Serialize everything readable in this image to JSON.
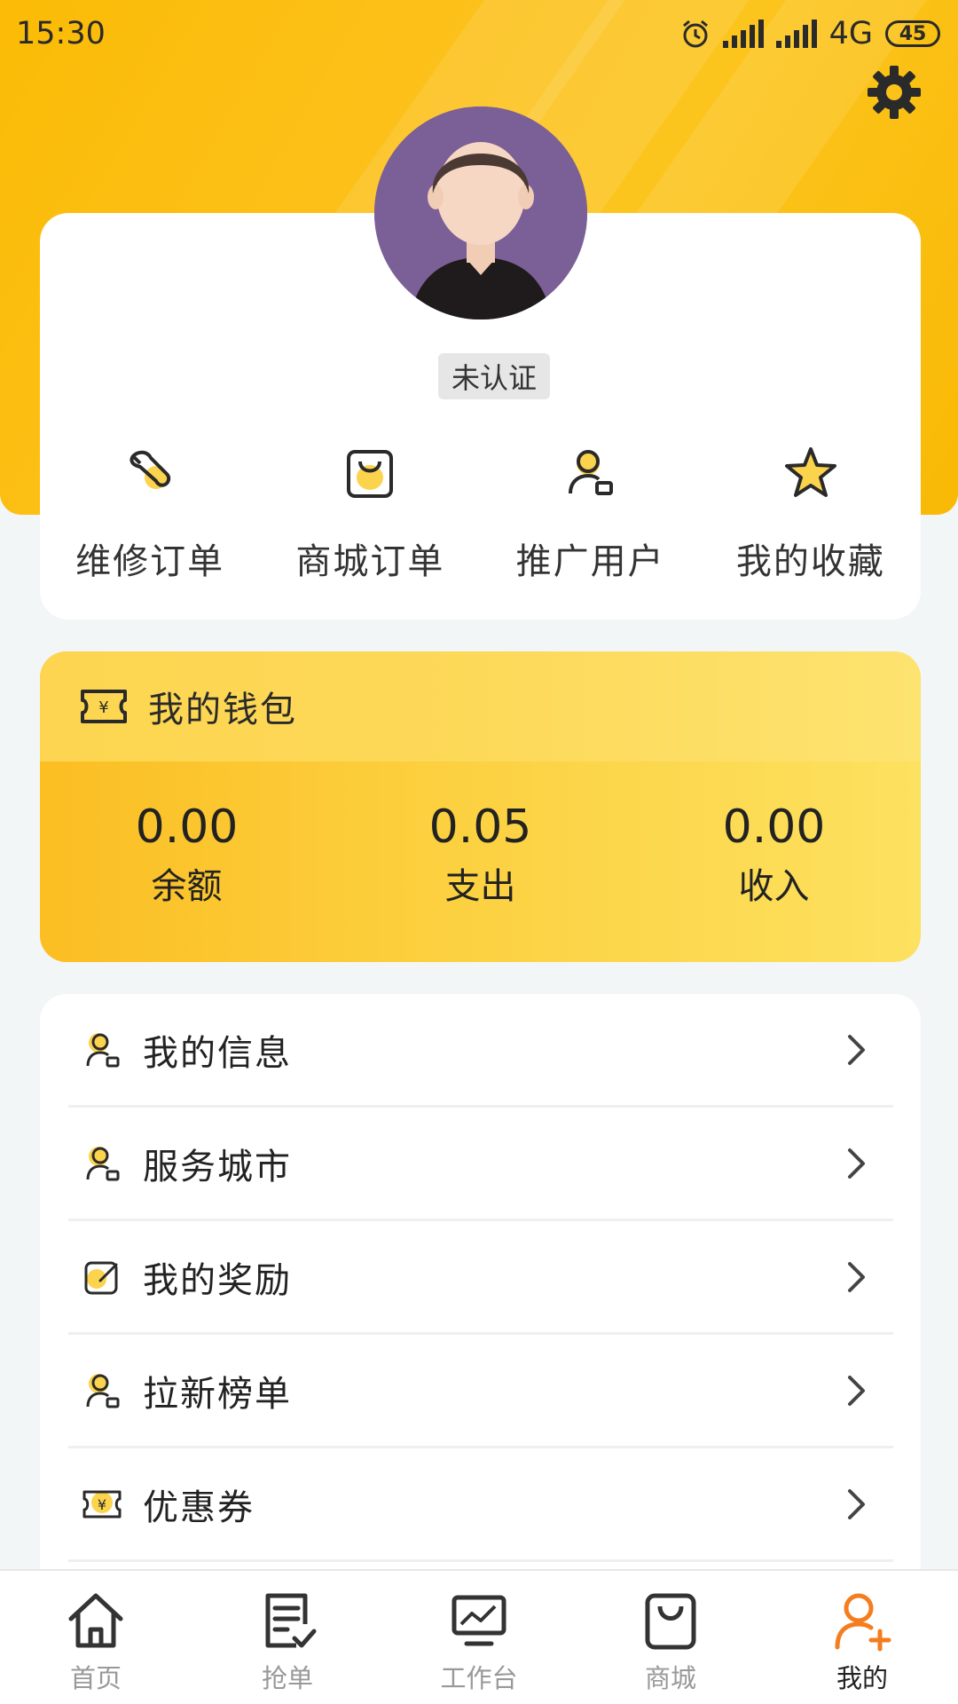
{
  "status_bar": {
    "time": "15:30",
    "network": "4G",
    "battery": "45"
  },
  "profile": {
    "verify_status": "未认证"
  },
  "quick_actions": [
    {
      "label": "维修订单",
      "icon": "wrench-icon"
    },
    {
      "label": "商城订单",
      "icon": "shopping-bag-icon"
    },
    {
      "label": "推广用户",
      "icon": "user-badge-icon"
    },
    {
      "label": "我的收藏",
      "icon": "star-icon"
    }
  ],
  "wallet": {
    "title": "我的钱包",
    "stats": [
      {
        "value": "0.00",
        "label": "余额"
      },
      {
        "value": "0.05",
        "label": "支出"
      },
      {
        "value": "0.00",
        "label": "收入"
      }
    ]
  },
  "menu": [
    {
      "label": "我的信息",
      "icon": "user-badge-icon"
    },
    {
      "label": "服务城市",
      "icon": "user-badge-icon"
    },
    {
      "label": "我的奖励",
      "icon": "edit-icon"
    },
    {
      "label": "拉新榜单",
      "icon": "user-badge-icon"
    },
    {
      "label": "优惠券",
      "icon": "ticket-icon"
    }
  ],
  "tabbar": [
    {
      "label": "首页",
      "icon": "home-icon",
      "active": false
    },
    {
      "label": "抢单",
      "icon": "order-check-icon",
      "active": false
    },
    {
      "label": "工作台",
      "icon": "monitor-chart-icon",
      "active": false
    },
    {
      "label": "商城",
      "icon": "shopping-bag-icon",
      "active": false
    },
    {
      "label": "我的",
      "icon": "user-add-icon",
      "active": true
    }
  ],
  "colors": {
    "accent": "#fbbb06",
    "active_tab": "#f47d1f",
    "icon_fill": "#fcd34d"
  }
}
